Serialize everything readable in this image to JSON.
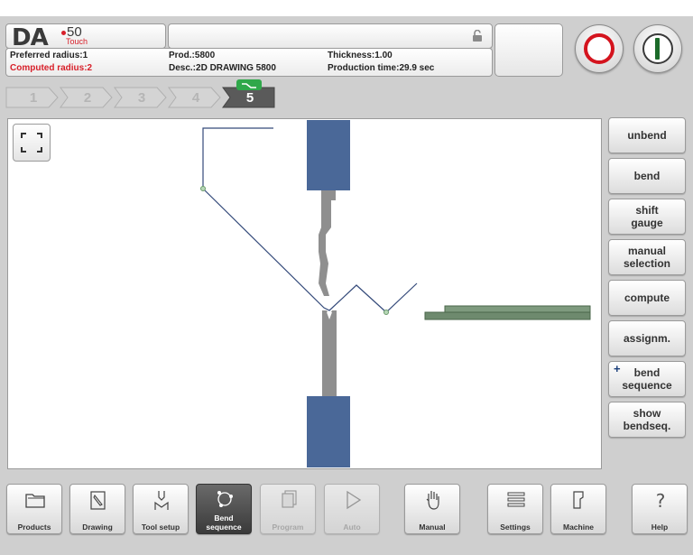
{
  "header": {
    "logo_brand": "DA",
    "logo_model": "50",
    "logo_sub": "Touch",
    "preferred_radius": "Preferred radius:1",
    "computed_radius": "Computed radius:2",
    "product": "Prod.:5800",
    "description": "Desc.:2D DRAWING 5800",
    "thickness": "Thickness:1.00",
    "production_time": "Production time:29.9 sec"
  },
  "colors": {
    "stop": "#d4141e",
    "start": "#1c6b2a",
    "tool": "#4a6898",
    "punch": "#8a8a8a",
    "product_line": "#344a7a",
    "gauge": "#6e8a6e"
  },
  "steps": [
    {
      "label": "1"
    },
    {
      "label": "2"
    },
    {
      "label": "3"
    },
    {
      "label": "4"
    },
    {
      "label": "5",
      "active": true
    }
  ],
  "side_buttons": [
    {
      "label": "unbend"
    },
    {
      "label": "bend"
    },
    {
      "label": "shift\ngauge"
    },
    {
      "label": "manual\nselection"
    },
    {
      "label": "compute"
    },
    {
      "label": "assignm."
    },
    {
      "label": "bend\nsequence",
      "plus": true
    },
    {
      "label": "show\nbendseq."
    }
  ],
  "bottom_nav": [
    {
      "label": "Products",
      "icon": "folder-icon"
    },
    {
      "label": "Drawing",
      "icon": "pencil-icon"
    },
    {
      "label": "Tool setup",
      "icon": "tool-icon"
    },
    {
      "label": "Bend\nsequence",
      "icon": "bend-sequence-icon",
      "active": true
    },
    {
      "label": "Program",
      "icon": "pages-icon",
      "disabled": true
    },
    {
      "label": "Auto",
      "icon": "play-icon",
      "disabled": true
    },
    {
      "label": "Manual",
      "icon": "hand-icon"
    },
    {
      "label": "Settings",
      "icon": "list-icon"
    },
    {
      "label": "Machine",
      "icon": "machine-icon"
    },
    {
      "label": "Help",
      "icon": "question-icon"
    }
  ]
}
